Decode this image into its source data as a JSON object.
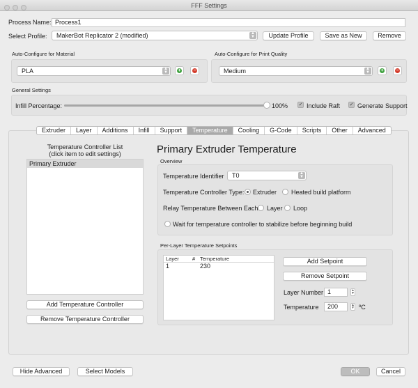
{
  "window": {
    "title": "FFF Settings"
  },
  "process": {
    "name_label": "Process Name:",
    "name_value": "Process1"
  },
  "profile": {
    "label": "Select Profile:",
    "value": "MakerBot Replicator 2 (modified)",
    "update_label": "Update Profile",
    "save_as_label": "Save as New",
    "remove_label": "Remove"
  },
  "material": {
    "group_label": "Auto-Configure for Material",
    "value": "PLA",
    "add_icon": "plus-icon",
    "remove_icon": "minus-icon",
    "add_color": "#3ea13e",
    "remove_color": "#d43c2c"
  },
  "quality": {
    "group_label": "Auto-Configure for Print Quality",
    "value": "Medium"
  },
  "general": {
    "group_label": "General Settings",
    "infill_label": "Infill Percentage:",
    "infill_value_text": "100%",
    "infill_fraction": 1.0,
    "raft_label": "Include Raft",
    "raft_checked": true,
    "support_label": "Generate Support",
    "support_checked": true
  },
  "tabs": [
    {
      "label": "Extruder",
      "active": false
    },
    {
      "label": "Layer",
      "active": false
    },
    {
      "label": "Additions",
      "active": false
    },
    {
      "label": "Infill",
      "active": false
    },
    {
      "label": "Support",
      "active": false
    },
    {
      "label": "Temperature",
      "active": true
    },
    {
      "label": "Cooling",
      "active": false
    },
    {
      "label": "G-Code",
      "active": false
    },
    {
      "label": "Scripts",
      "active": false
    },
    {
      "label": "Other",
      "active": false
    },
    {
      "label": "Advanced",
      "active": false
    }
  ],
  "controllers": {
    "list_title": "Temperature Controller List",
    "list_subtitle": "(click item to edit settings)",
    "items": [
      "Primary Extruder"
    ],
    "add_label": "Add Temperature Controller",
    "remove_label": "Remove Temperature Controller"
  },
  "detail": {
    "heading": "Primary Extruder Temperature",
    "overview_label": "Overview",
    "identifier_label": "Temperature Identifier",
    "identifier_value": "T0",
    "type_label": "Temperature Controller Type:",
    "type_options": [
      {
        "label": "Extruder",
        "selected": true
      },
      {
        "label": "Heated build platform",
        "selected": false
      }
    ],
    "relay_label": "Relay Temperature Between Each:",
    "relay_options": [
      {
        "label": "Layer",
        "selected": false
      },
      {
        "label": "Loop",
        "selected": false
      }
    ],
    "wait_label": "Wait for temperature controller to stabilize before beginning build",
    "wait_checked": false
  },
  "setpoints": {
    "group_label": "Per-Layer Temperature Setpoints",
    "columns": [
      "Layer",
      "#",
      "Temperature"
    ],
    "rows": [
      {
        "layer": "1",
        "temperature": "230"
      }
    ],
    "add_label": "Add Setpoint",
    "remove_label": "Remove Setpoint",
    "layer_number_label": "Layer Number",
    "layer_number_value": "1",
    "temperature_label": "Temperature",
    "temperature_value": "200",
    "temperature_unit": "ºC"
  },
  "footer": {
    "hide_advanced_label": "Hide Advanced",
    "select_models_label": "Select Models",
    "ok_label": "OK",
    "cancel_label": "Cancel"
  }
}
